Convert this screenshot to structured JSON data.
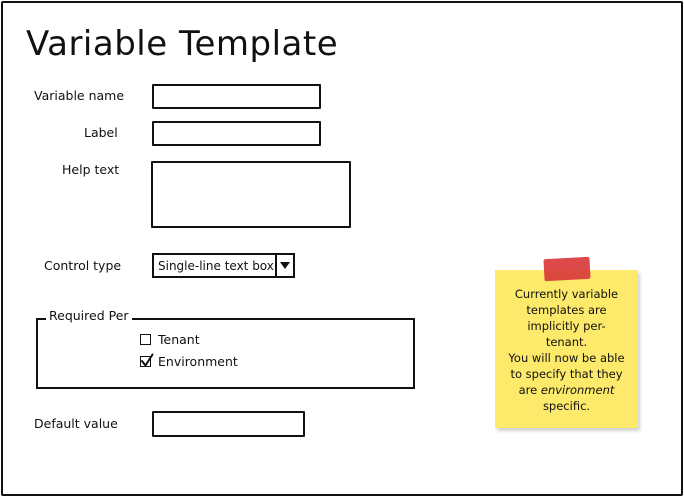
{
  "page": {
    "title": "Variable Template"
  },
  "form": {
    "variable_name_label": "Variable name",
    "label_label": "Label",
    "help_text_label": "Help text",
    "control_type_label": "Control type",
    "control_type_value": "Single-line text box",
    "required_per_legend": "Required Per",
    "tenant_label": "Tenant",
    "tenant_checked": false,
    "environment_label": "Environment",
    "environment_checked": true,
    "default_value_label": "Default value"
  },
  "note": {
    "line1": "Currently variable",
    "line2": "templates are",
    "line3": "implicitly per-",
    "line4": "tenant.",
    "line5": "You will now be able",
    "line6": "to specify that they",
    "line7_prefix": "are ",
    "line7_em": "environment",
    "line8": "specific.",
    "color": "#fde96a",
    "tape_color": "#d83a3a"
  }
}
